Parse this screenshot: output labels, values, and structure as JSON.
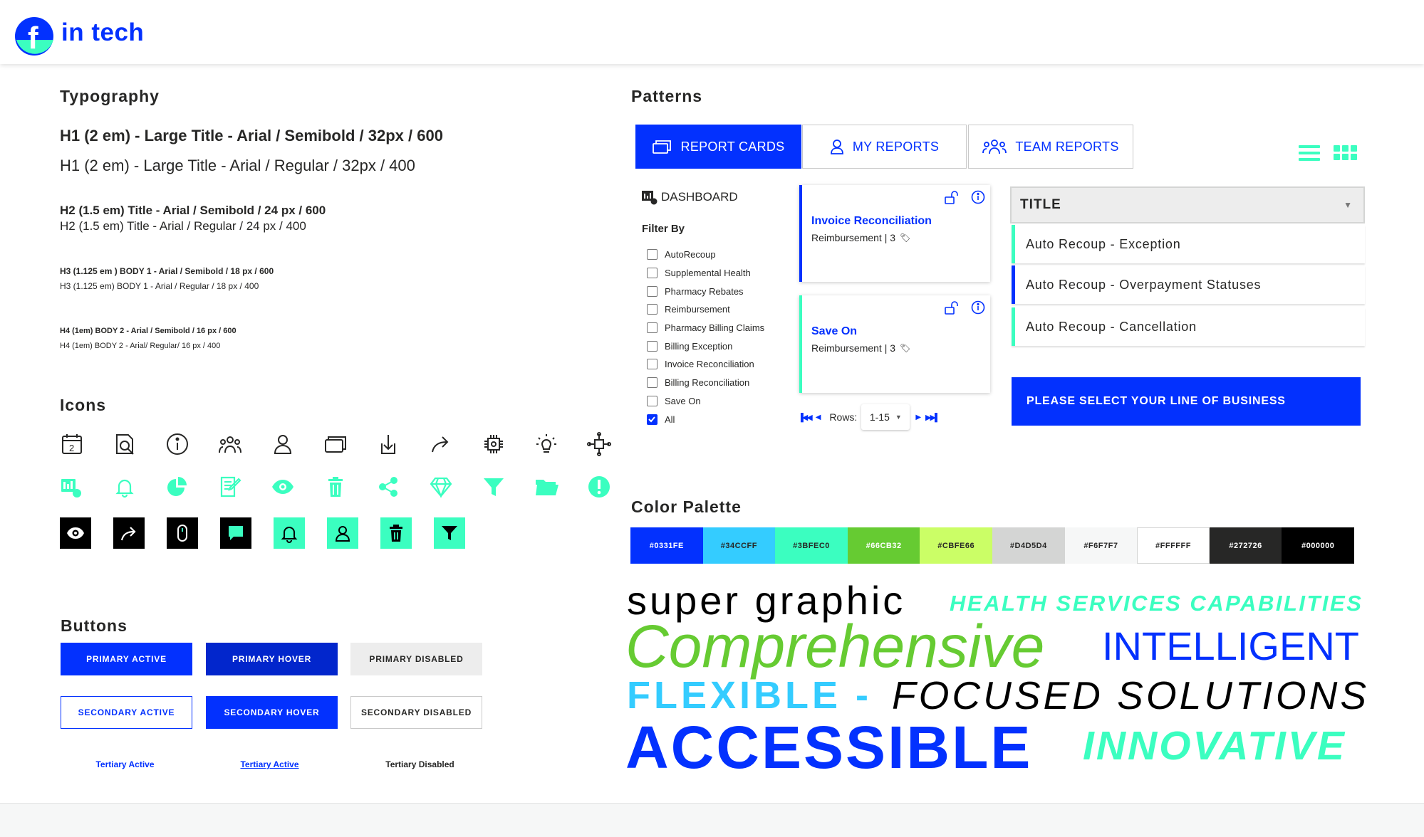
{
  "header": {
    "logo_text": "in tech"
  },
  "typography": {
    "title": "Typography",
    "samples": [
      "H1 (2 em) - Large Title - Arial / Semibold / 32px / 600",
      "H1 (2 em) - Large Title - Arial / Regular / 32px / 400",
      "H2 (1.5 em) Title -  Arial / Semibold / 24 px / 600",
      "H2 (1.5 em) Title -  Arial / Regular / 24 px / 400",
      "H3 (1.125 em ) BODY 1 - Arial / Semibold / 18 px / 600",
      "H3 (1.125 em) BODY 1 - Arial / Regular / 18 px / 400",
      "H4 (1em) BODY 2 - Arial / Semibold / 16 px / 600",
      "H4 (1em) BODY 2 - Arial/ Regular/ 16 px / 400"
    ]
  },
  "icons": {
    "title": "Icons",
    "row1": [
      "calendar-icon",
      "search-document-icon",
      "info-icon",
      "team-icon",
      "user-icon",
      "cards-icon",
      "download-icon",
      "share-arrow-icon",
      "chip-icon",
      "bulb-settings-icon",
      "network-icon"
    ],
    "row2": [
      "dashboard-money-icon",
      "bell-icon",
      "pie-chart-icon",
      "edit-document-icon",
      "eye-icon",
      "trash-icon",
      "share-icon",
      "diamond-icon",
      "filter-icon",
      "folder-icon",
      "alert-icon"
    ],
    "row3": [
      "eye-icon",
      "share-arrow-icon",
      "mouse-icon",
      "chat-icon",
      "bell-icon",
      "user-icon",
      "trash-icon",
      "filter-icon"
    ]
  },
  "buttons": {
    "title": "Buttons",
    "primary_active": "PRIMARY ACTIVE",
    "primary_hover": "PRIMARY HOVER",
    "primary_disabled": "PRIMARY DISABLED",
    "secondary_active": "SECONDARY ACTIVE",
    "secondary_hover": "SECONDARY HOVER",
    "secondary_disabled": "SECONDARY DISABLED",
    "tertiary_active": "Tertiary Active",
    "tertiary_active_hover": "Tertiary Active",
    "tertiary_disabled": "Tertiary Disabled"
  },
  "patterns": {
    "title": "Patterns",
    "tabs": [
      {
        "label": "REPORT CARDS",
        "active": true
      },
      {
        "label": "MY REPORTS",
        "active": false
      },
      {
        "label": "TEAM REPORTS",
        "active": false
      }
    ],
    "dashboard_label": "DASHBOARD",
    "filter_by": "Filter By",
    "filters": [
      {
        "label": "AutoRecoup",
        "checked": false
      },
      {
        "label": "Supplemental Health",
        "checked": false
      },
      {
        "label": "Pharmacy Rebates",
        "checked": false
      },
      {
        "label": "Reimbursement",
        "checked": false
      },
      {
        "label": "Pharmacy Billing Claims",
        "checked": false
      },
      {
        "label": "Billing Exception",
        "checked": false
      },
      {
        "label": "Invoice Reconciliation",
        "checked": false
      },
      {
        "label": "Billing Reconciliation",
        "checked": false
      },
      {
        "label": "Save On",
        "checked": false
      },
      {
        "label": "All",
        "checked": true
      }
    ],
    "cards": [
      {
        "title": "Invoice Reconciliation",
        "subtitle": "Reimbursement | 3",
        "bar_color": "#0331FE"
      },
      {
        "title": "Save On",
        "subtitle": "Reimbursement  | 3",
        "bar_color": "#3BFEC0"
      }
    ],
    "pagination": {
      "rows_label": "Rows:",
      "rows_value": "1-15"
    },
    "dropdown_title": "TITLE",
    "list_items": [
      "Auto Recoup - Exception",
      "Auto Recoup - Overpayment Statuses",
      "Auto Recoup - Cancellation"
    ],
    "cta": "PLEASE SELECT YOUR LINE OF BUSINESS"
  },
  "palette": {
    "title": "Color Palette",
    "colors": [
      "#0331FE",
      "#34CCFF",
      "#3BFEC0",
      "#66CB32",
      "#CBFE66",
      "#D4D5D4",
      "#F6F7F7",
      "#FFFFFF",
      "#272726",
      "#000000"
    ]
  },
  "wordcloud": {
    "super_graphic": "super graphic",
    "health": "HEALTH SERVICES CAPABILITIES",
    "comprehensive": "Comprehensive",
    "intelligent": "INTELLIGENT",
    "flexible": "FLEXIBLE -",
    "focused": "FOCUSED SOLUTIONS",
    "accessible": "ACCESSIBLE",
    "innovative": "INNOVATIVE"
  }
}
